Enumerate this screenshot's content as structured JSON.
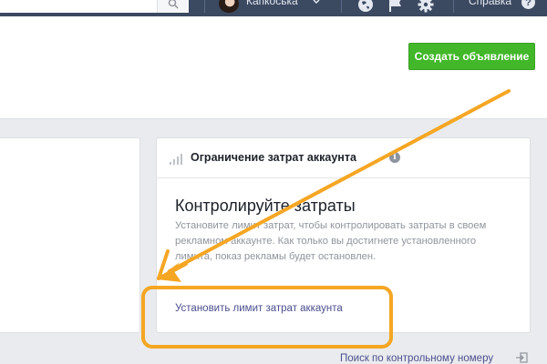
{
  "topbar": {
    "user_name": "Капкоська",
    "help_label": "Справка",
    "help_icon_glyph": "?",
    "colors": {
      "background": "#3b4961",
      "text": "#e4e8f0"
    }
  },
  "header": {
    "create_ad_label": "Создать объявление",
    "create_ad_color": "#42b72a"
  },
  "spend_limit_card": {
    "title": "Ограничение затрат аккаунта",
    "info_icon_glyph": "i",
    "heading": "Контролируйте затраты",
    "description": "Установите лимит затрат, чтобы контролировать затраты в своем рекламном аккаунте. Как только вы достигнете установленного лимита, показ рекламы будет остановлен.",
    "link_label": "Установить лимит затрат аккаунта"
  },
  "footer": {
    "search_control_number_label": "Поиск по контрольному номеру"
  },
  "annotation": {
    "color": "#f5a623",
    "icons": [
      "arrow-icon",
      "highlight-box"
    ]
  },
  "icons": [
    "search-icon",
    "chevron-down-icon",
    "globe-icon",
    "flag-icon",
    "gear-icon",
    "help-icon",
    "signal-bars-icon",
    "info-icon",
    "exit-icon"
  ]
}
